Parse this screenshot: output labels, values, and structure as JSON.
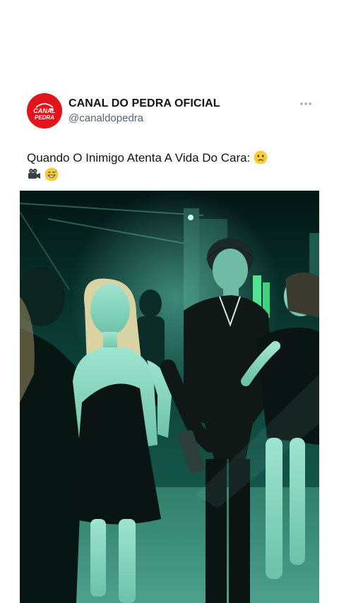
{
  "post": {
    "author": {
      "display_name": "CANAL DO PEDRA OFICIAL",
      "handle": "@canaldopedra",
      "avatar_logo_text": "CANAL do PEDRA"
    },
    "text_line1": "Quando O Inimigo Atenta A Vida Do Cara:",
    "emojis": [
      "crying-face-emoji",
      "movie-camera-emoji",
      "grinning-sweat-face-emoji"
    ],
    "media": {
      "type": "video-frame",
      "description_icon": "nightclub-scene"
    }
  },
  "colors": {
    "brand_red": "#e2141c",
    "text_primary": "#0f1419",
    "text_secondary": "#536471",
    "media_tint": "#0c4a3e"
  },
  "icons": {
    "more": "more-horizontal-icon"
  }
}
